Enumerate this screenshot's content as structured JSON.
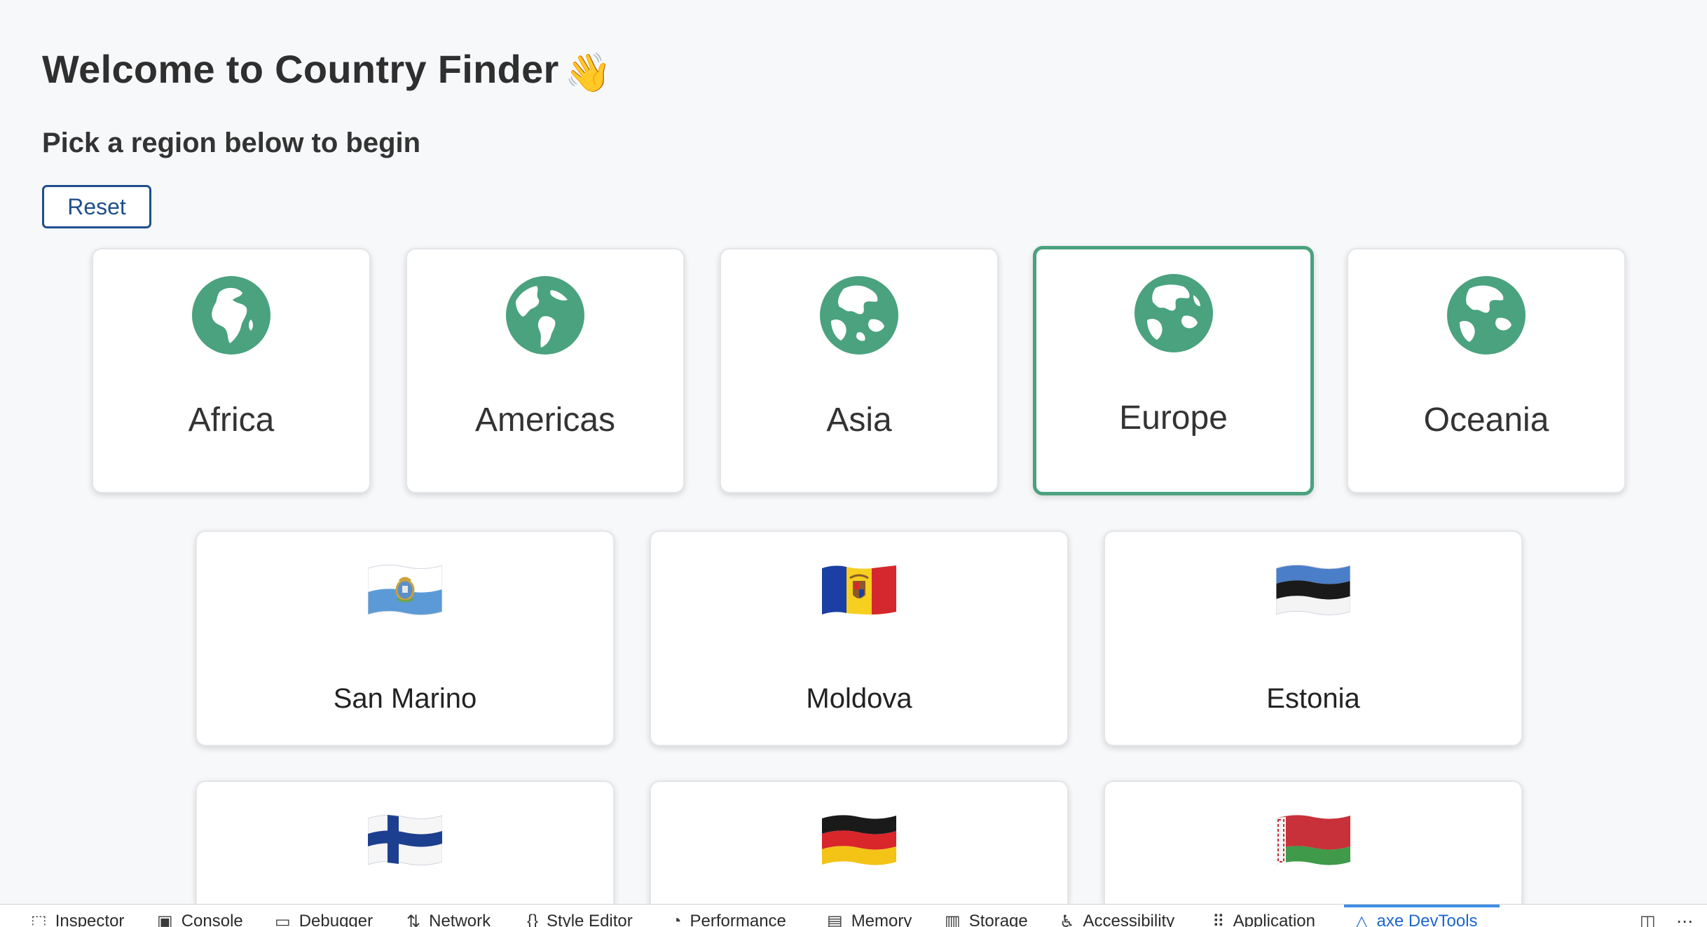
{
  "header": {
    "title": "Welcome to Country Finder",
    "title_emoji": "👋",
    "subtitle": "Pick a region below to begin",
    "reset_label": "Reset"
  },
  "regions": [
    {
      "label": "Africa",
      "icon": "globe-africa-icon",
      "selected": false
    },
    {
      "label": "Americas",
      "icon": "globe-americas-icon",
      "selected": false
    },
    {
      "label": "Asia",
      "icon": "globe-asia-icon",
      "selected": false
    },
    {
      "label": "Europe",
      "icon": "globe-europe-icon",
      "selected": true
    },
    {
      "label": "Oceania",
      "icon": "globe-oceania-icon",
      "selected": false
    }
  ],
  "countries": [
    {
      "name": "San Marino",
      "flag": "flag-san-marino-icon"
    },
    {
      "name": "Moldova",
      "flag": "flag-moldova-icon"
    },
    {
      "name": "Estonia",
      "flag": "flag-estonia-icon"
    },
    {
      "name": "",
      "flag": "flag-finland-icon"
    },
    {
      "name": "",
      "flag": "flag-germany-icon"
    },
    {
      "name": "",
      "flag": "flag-belarus-icon"
    }
  ],
  "devtools": {
    "tabs": [
      {
        "label": "Inspector",
        "icon": "inspector-icon"
      },
      {
        "label": "Console",
        "icon": "console-icon"
      },
      {
        "label": "Debugger",
        "icon": "debugger-icon"
      },
      {
        "label": "Network",
        "icon": "network-icon"
      },
      {
        "label": "Style Editor",
        "icon": "style-editor-icon"
      },
      {
        "label": "Performance",
        "icon": "performance-icon"
      },
      {
        "label": "Memory",
        "icon": "memory-icon"
      },
      {
        "label": "Storage",
        "icon": "storage-icon"
      },
      {
        "label": "Accessibility",
        "icon": "accessibility-icon"
      },
      {
        "label": "Application",
        "icon": "application-icon"
      },
      {
        "label": "axe DevTools",
        "icon": "axe-icon",
        "active": true
      }
    ]
  },
  "colors": {
    "accent_green": "#4aa27e",
    "button_blue": "#1f4e8c",
    "devtools_active": "#1d66d0"
  }
}
